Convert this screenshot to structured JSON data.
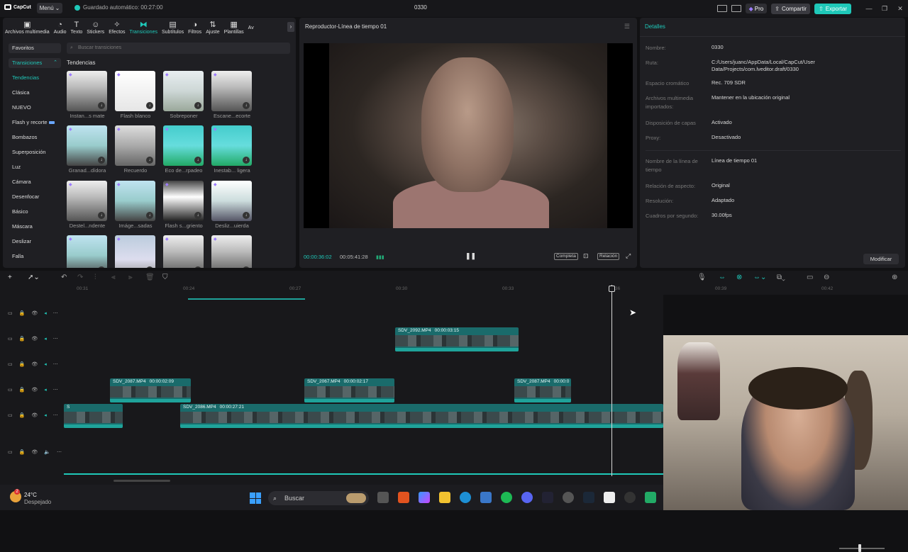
{
  "titlebar": {
    "logo": "CapCut",
    "menu": "Menú",
    "autosave": "Guardado automático: 00:27:00",
    "project_title": "0330",
    "pro": "Pro",
    "share": "Compartir",
    "export": "Exportar"
  },
  "toolbar": {
    "tools": [
      "Archivos multimedia",
      "Audio",
      "Texto",
      "Stickers",
      "Efectos",
      "Transiciones",
      "Subtítulos",
      "Filtros",
      "Ajuste",
      "Plantillas",
      "Av"
    ],
    "active": "Transiciones"
  },
  "categories": {
    "favorites": "Favoritos",
    "section": "Transiciones",
    "items": [
      "Tendencias",
      "Clásica",
      "NUEVO",
      "Flash y recorte",
      "Bombazos",
      "Superposición",
      "Luz",
      "Cámara",
      "Desenfocar",
      "Básico",
      "Máscara",
      "Deslizar",
      "Falla"
    ],
    "selected": "Tendencias"
  },
  "search": {
    "placeholder": "Buscar transiciones"
  },
  "trending_header": "Tendencias",
  "transitions": [
    {
      "label": "Instan...s mate",
      "style": "bw"
    },
    {
      "label": "Flash blanco",
      "style": "white"
    },
    {
      "label": "Sobreponer",
      "style": "sea"
    },
    {
      "label": "Escane...ecorte",
      "style": "bw"
    },
    {
      "label": "Granad...dídora",
      "style": "blue"
    },
    {
      "label": "Recuerdo",
      "style": "gray"
    },
    {
      "label": "Eco de...rpadeo",
      "style": "teal"
    },
    {
      "label": "Inestab... ligera",
      "style": "teal"
    },
    {
      "label": "Destel...ndente",
      "style": "bw"
    },
    {
      "label": "Imáge...sadas",
      "style": "blue"
    },
    {
      "label": "Flash s...griento",
      "style": "mountain"
    },
    {
      "label": "Desliz...uierda",
      "style": "city"
    },
    {
      "label": "",
      "style": "blue"
    },
    {
      "label": "",
      "style": "car"
    },
    {
      "label": "",
      "style": "bw"
    },
    {
      "label": "",
      "style": "bw"
    }
  ],
  "player": {
    "title": "Reproductor-Línea de tiempo 01",
    "current_time": "00:00:36:02",
    "total_time": "00:05:41:28",
    "full_label": "Completa",
    "ratio_label": "Relación"
  },
  "details": {
    "header": "Detalles",
    "rows": [
      {
        "k": "Nombre:",
        "v": "0330"
      },
      {
        "k": "Ruta:",
        "v": "C:/Users/juanc/AppData/Local/CapCut/User Data/Projects/com.lveditor.draft/0330"
      },
      {
        "k": "Espacio cromático",
        "v": "Rec. 709 SDR"
      },
      {
        "k": "Archivos multimedia importados:",
        "v": "Mantener en la ubicación original"
      },
      {
        "k": "Disposición de capas",
        "v": "Activado"
      },
      {
        "k": "Proxy:",
        "v": "Desactivado"
      },
      {
        "k": "Nombre de la línea de tiempo",
        "v": "Línea de tiempo 01"
      },
      {
        "k": "Relación de aspecto:",
        "v": "Original"
      },
      {
        "k": "Resolución:",
        "v": "Adaptado"
      },
      {
        "k": "Cuadros por segundo:",
        "v": "30.00fps"
      }
    ],
    "modify": "Modificar"
  },
  "ruler": [
    "00:31",
    "00:24",
    "00:27",
    "00:30",
    "00:33",
    "00:36",
    "00:39",
    "00:42"
  ],
  "clips": [
    {
      "name": "SDV_2092.MP4",
      "dur": "00:00:03:15"
    },
    {
      "name": "SDV_2087.MP4",
      "dur": "00:00:02:09"
    },
    {
      "name": "SDV_2067.MP4",
      "dur": "00:00:02:17"
    },
    {
      "name": "SDV_2087.MP4",
      "dur": "00:00:0"
    },
    {
      "name": "S",
      "dur": ""
    },
    {
      "name": "SDV_2086.MP4",
      "dur": "00:00:27:21"
    }
  ],
  "taskbar": {
    "temp": "24°C",
    "weather": "Despejado",
    "search": "Buscar"
  }
}
